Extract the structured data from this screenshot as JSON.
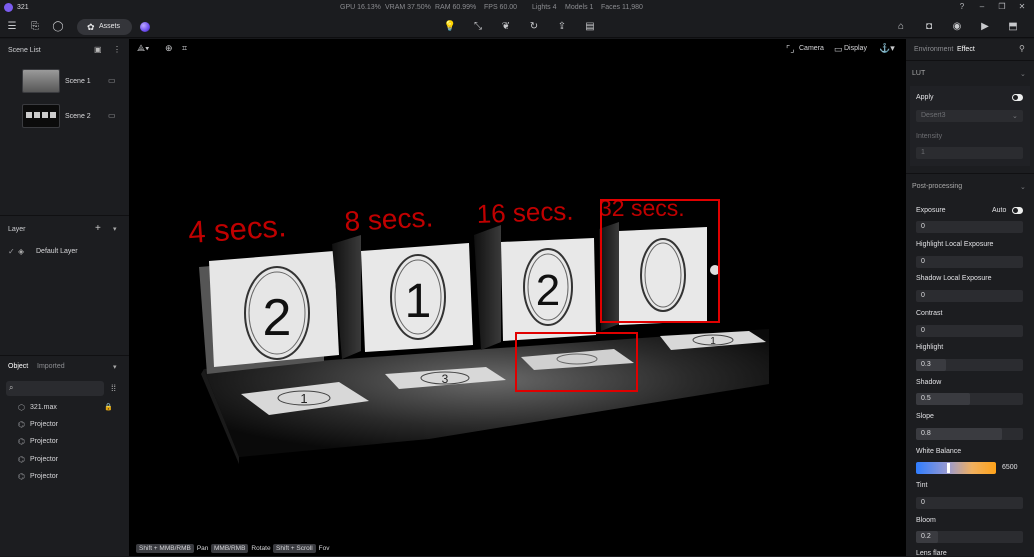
{
  "app": {
    "title": "321"
  },
  "stats": {
    "gpu": "GPU 16.13%",
    "vram": "VRAM 37.50%",
    "ram": "RAM 60.99%",
    "fps": "FPS 60.00",
    "lights": "Lights 4",
    "models": "Models 1",
    "faces": "Faces 11,980"
  },
  "toolbar": {
    "assets_label": "Assets"
  },
  "scene_list": {
    "title": "Scene List",
    "scenes": [
      {
        "label": "Scene 1"
      },
      {
        "label": "Scene 2"
      }
    ]
  },
  "layer": {
    "title": "Layer",
    "items": [
      {
        "label": "Default Layer"
      }
    ]
  },
  "object_panel": {
    "tabs": [
      {
        "label": "Object"
      },
      {
        "label": "Imported"
      }
    ],
    "items": [
      {
        "label": "321.max",
        "icon": "cube-icon"
      },
      {
        "label": "Projector",
        "icon": "projector-icon"
      },
      {
        "label": "Projector",
        "icon": "projector-icon"
      },
      {
        "label": "Projector",
        "icon": "projector-icon"
      },
      {
        "label": "Projector",
        "icon": "projector-icon"
      }
    ]
  },
  "viewport": {
    "camera_label": "Camera",
    "display_label": "Display",
    "annotations": [
      "4 secs.",
      "8 secs.",
      "16 secs.",
      "32 secs."
    ],
    "screens": [
      "2",
      "1",
      "2",
      ""
    ],
    "floor_numbers": [
      "1",
      "3",
      "",
      "1"
    ],
    "hints": [
      {
        "key": "Shift + MMB/RMB",
        "action": "Pan"
      },
      {
        "key": "MMB/RMB",
        "action": "Rotate"
      },
      {
        "key": "Shift + Scroll",
        "action": "Fov"
      }
    ]
  },
  "right_panel": {
    "tabs": [
      {
        "label": "Environment"
      },
      {
        "label": "Effect"
      }
    ],
    "lut": {
      "title": "LUT",
      "apply_label": "Apply",
      "preset": "Desert3",
      "intensity_label": "Intensity",
      "intensity_value": "1"
    },
    "post": {
      "title": "Post-processing",
      "exposure_label": "Exposure",
      "auto_label": "Auto",
      "exposure_value": "0",
      "highlight_local_label": "Highlight Local Exposure",
      "highlight_local_value": "0",
      "shadow_local_label": "Shadow Local Exposure",
      "shadow_local_value": "0",
      "contrast_label": "Contrast",
      "contrast_value": "0",
      "highlight_label": "Highlight",
      "highlight_value": "0.3",
      "shadow_label": "Shadow",
      "shadow_value": "0.5",
      "slope_label": "Slope",
      "slope_value": "0.8",
      "wb_label": "White Balance",
      "wb_value": "6500",
      "tint_label": "Tint",
      "tint_value": "0",
      "bloom_label": "Bloom",
      "bloom_value": "0.2",
      "lensflare_label": "Lens flare"
    }
  }
}
